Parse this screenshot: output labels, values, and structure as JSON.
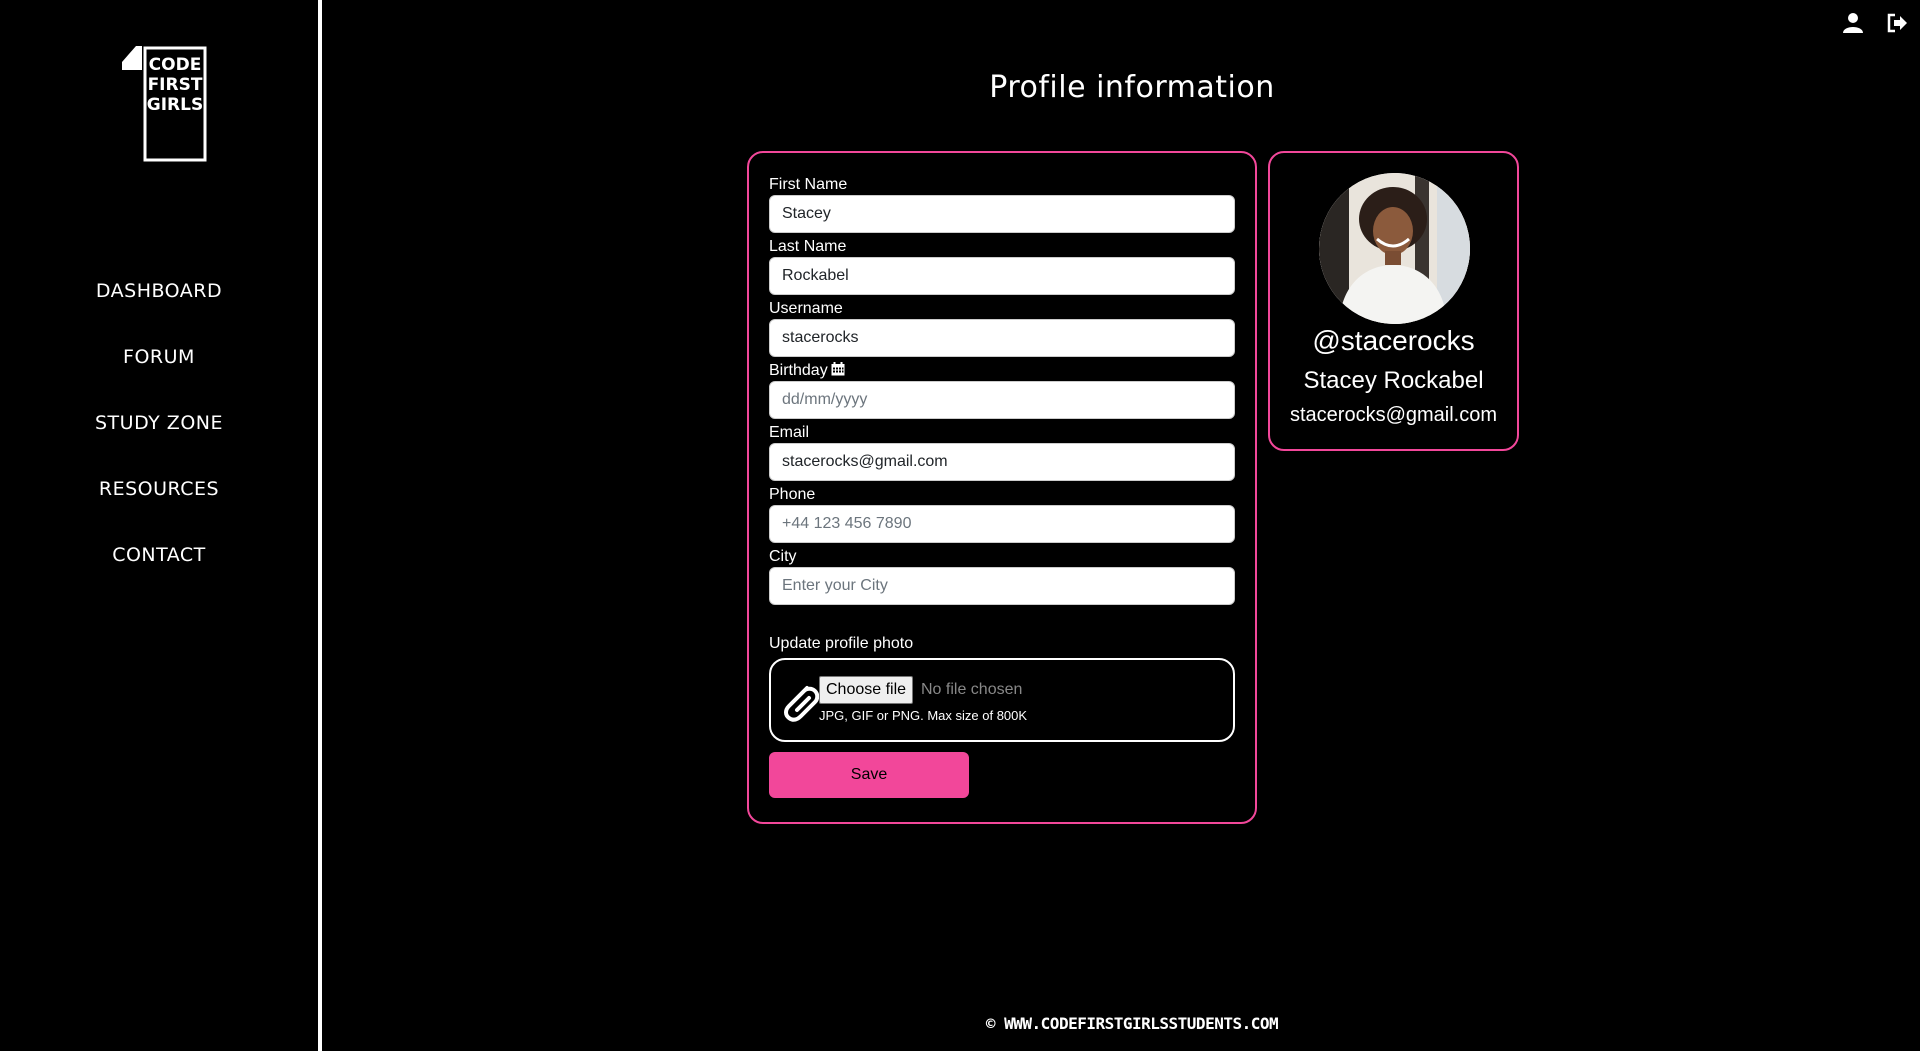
{
  "brand": {
    "logo_text": [
      "CODE",
      "FIRST",
      "GIRLS"
    ]
  },
  "sidebar": {
    "items": [
      {
        "label": "DASHBOARD"
      },
      {
        "label": "FORUM"
      },
      {
        "label": "STUDY ZONE"
      },
      {
        "label": "RESOURCES"
      },
      {
        "label": "CONTACT"
      }
    ]
  },
  "header": {
    "icons": [
      "user-icon",
      "logout-icon"
    ]
  },
  "page": {
    "title": "Profile information"
  },
  "form": {
    "first_name": {
      "label": "First Name",
      "value": "Stacey"
    },
    "last_name": {
      "label": "Last Name",
      "value": "Rockabel"
    },
    "username": {
      "label": "Username",
      "value": "stacerocks"
    },
    "birthday": {
      "label": "Birthday",
      "value": "",
      "placeholder": "dd/mm/yyyy"
    },
    "email": {
      "label": "Email",
      "value": "stacerocks@gmail.com"
    },
    "phone": {
      "label": "Phone",
      "value": "",
      "placeholder": "+44 123 456 7890"
    },
    "city": {
      "label": "City",
      "value": "",
      "placeholder": "Enter your City"
    },
    "photo": {
      "label": "Update profile photo",
      "button": "Choose file",
      "status": "No file chosen",
      "hint": "JPG, GIF or PNG. Max size of 800K"
    },
    "save_label": "Save"
  },
  "profile": {
    "handle": "@stacerocks",
    "name": "Stacey Rockabel",
    "email": "stacerocks@gmail.com"
  },
  "footer": {
    "text": "© WWW.CODEFIRSTGIRLSSTUDENTS.COM"
  },
  "colors": {
    "accent": "#f2479a",
    "background": "#000000"
  }
}
